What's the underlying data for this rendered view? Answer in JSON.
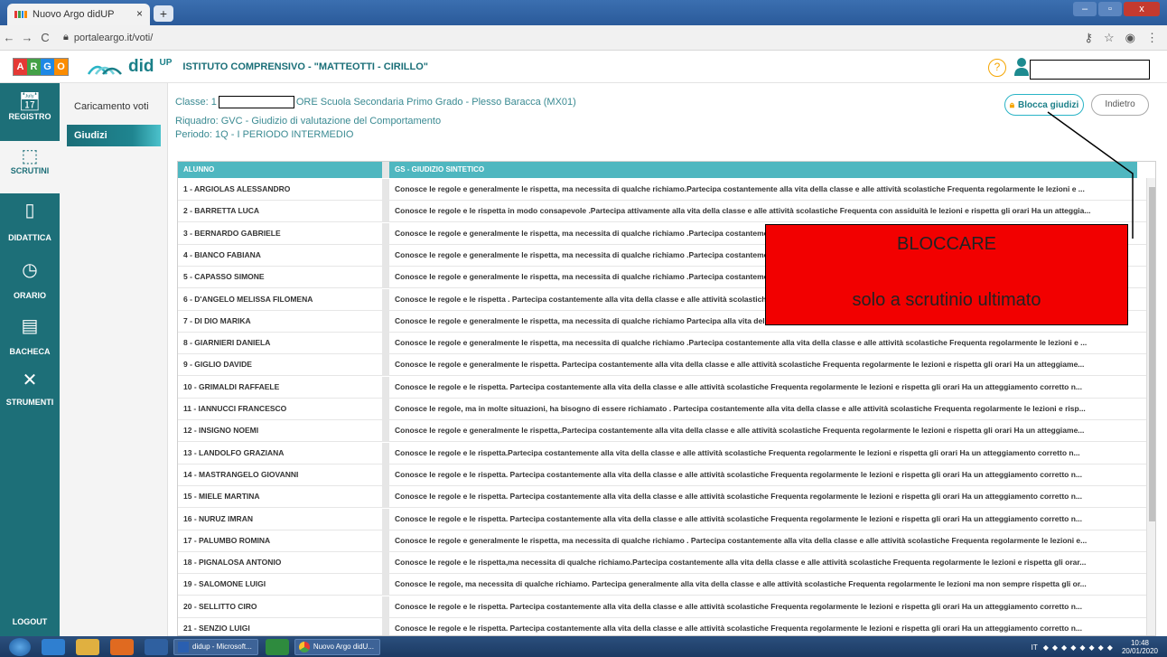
{
  "browser": {
    "tab_title": "Nuovo Argo didUP",
    "tab_close": "×",
    "new_tab": "+",
    "url": "portaleargo.it/voti/",
    "window_controls": [
      "–",
      "▫",
      "x"
    ]
  },
  "header": {
    "brand_letters": [
      "A",
      "R",
      "G",
      "O"
    ],
    "brand_colors": [
      "#e53935",
      "#43a047",
      "#1e88e5",
      "#fb8c00"
    ],
    "app_name": "did",
    "app_sup": "UP",
    "school": "ISTITUTO COMPRENSIVO - \"MATTEOTTI - CIRILLO\"",
    "help_icon": "?"
  },
  "leftnav": {
    "items": [
      {
        "label": "REGISTRO",
        "icon": "calendar-icon"
      },
      {
        "label": "SCRUTINI",
        "icon": "scrutini-icon"
      },
      {
        "label": "DIDATTICA",
        "icon": "book-icon"
      },
      {
        "label": "ORARIO",
        "icon": "clock-icon"
      },
      {
        "label": "BACHECA",
        "icon": "board-icon"
      },
      {
        "label": "STRUMENTI",
        "icon": "tools-icon"
      }
    ],
    "logout": "LOGOUT"
  },
  "submenu": {
    "items": [
      "Caricamento voti",
      "Giudizi"
    ]
  },
  "info": {
    "class_prefix": "Classe: 1",
    "class_suffix": "ORE Scuola Secondaria Primo Grado - Plesso Baracca (MX01)",
    "riquadro": "Riquadro: GVC - Giudizio di valutazione del Comportamento",
    "periodo": "Periodo: 1Q - I PERIODO INTERMEDIO"
  },
  "buttons": {
    "blocca": "Blocca giudizi",
    "indietro": "Indietro"
  },
  "table": {
    "headers": [
      "ALUNNO",
      "GS - GIUDIZIO SINTETICO"
    ],
    "rows": [
      {
        "name": "1 - ARGIOLAS ALESSANDRO",
        "giudizio": "Conosce le regole e generalmente le rispetta, ma necessita di qualche richiamo.Partecipa costantemente alla vita della classe e alle attività scolastiche Frequenta regolarmente le lezioni e ..."
      },
      {
        "name": "2 - BARRETTA LUCA",
        "giudizio": "Conosce le regole e le rispetta in modo consapevole .Partecipa attivamente alla vita della classe e alle attività scolastiche Frequenta con assiduità le lezioni e rispetta gli orari Ha un atteggia..."
      },
      {
        "name": "3 - BERNARDO GABRIELE",
        "giudizio": "Conosce le regole e generalmente le rispetta, ma necessita di qualche richiamo .Partecipa costantemente alla vita della classe e alle attività scolastiche Frequenta regolarmente le lezioni e ..."
      },
      {
        "name": "4 - BIANCO FABIANA",
        "giudizio": "Conosce le regole e generalmente le rispetta, ma necessita di qualche richiamo .Partecipa costantemente alla vita della classe e alle attività scolastiche Frequenta regolarmente le lezioni e ..."
      },
      {
        "name": "5 - CAPASSO SIMONE",
        "giudizio": "Conosce le regole e generalmente le rispetta, ma necessita di qualche richiamo .Partecipa costantemente alla vita della classe e alle attività scolastiche Frequenta regolarmente le lezioni e ..."
      },
      {
        "name": "6 - D'ANGELO MELISSA FILOMENA",
        "giudizio": "Conosce le regole e le rispetta . Partecipa costantemente alla vita della classe e alle attività scolastiche Frequenta regolarmente le lezioni e rispetta gli orari Ha un atteggiamento corretto n..."
      },
      {
        "name": "7 - DI DIO MARIKA",
        "giudizio": "Conosce le regole e generalmente le rispetta, ma necessita di qualche richiamo Partecipa alla vita della classe e alle attività scolastiche Frequenta regolarmente le lezioni e rispetta gli orari..."
      },
      {
        "name": "8 - GIARNIERI DANIELA",
        "giudizio": "Conosce le regole e generalmente le rispetta, ma necessita di qualche richiamo .Partecipa costantemente alla vita della classe e alle attività scolastiche Frequenta regolarmente le lezioni e ..."
      },
      {
        "name": "9 - GIGLIO DAVIDE",
        "giudizio": "Conosce le regole e generalmente le rispetta. Partecipa costantemente alla vita della classe e alle attività scolastiche Frequenta regolarmente le lezioni e rispetta gli orari Ha un atteggiame..."
      },
      {
        "name": "10 - GRIMALDI RAFFAELE",
        "giudizio": "Conosce le regole e le rispetta. Partecipa costantemente alla vita della classe e alle attività scolastiche Frequenta regolarmente le lezioni e rispetta gli orari Ha un atteggiamento corretto n..."
      },
      {
        "name": "11 - IANNUCCI FRANCESCO",
        "giudizio": "Conosce le regole, ma in molte situazioni, ha bisogno di essere richiamato . Partecipa costantemente alla vita della classe e alle attività scolastiche Frequenta regolarmente le lezioni e risp..."
      },
      {
        "name": "12 - INSIGNO NOEMI",
        "giudizio": "Conosce le regole e generalmente le rispetta,.Partecipa costantemente alla vita della classe e alle attività scolastiche Frequenta regolarmente le lezioni e rispetta gli orari Ha un atteggiame..."
      },
      {
        "name": "13 - LANDOLFO GRAZIANA",
        "giudizio": "Conosce le regole e le rispetta.Partecipa costantemente alla vita della classe e alle attività scolastiche Frequenta regolarmente le lezioni e rispetta gli orari Ha un atteggiamento corretto n..."
      },
      {
        "name": "14 - MASTRANGELO GIOVANNI",
        "giudizio": "Conosce le regole e le rispetta. Partecipa costantemente alla vita della classe e alle attività scolastiche Frequenta regolarmente le lezioni e rispetta gli orari Ha un atteggiamento corretto n..."
      },
      {
        "name": "15 - MIELE MARTINA",
        "giudizio": "Conosce le regole e le rispetta. Partecipa costantemente alla vita della classe e alle attività scolastiche Frequenta regolarmente le lezioni e rispetta gli orari Ha un atteggiamento corretto n..."
      },
      {
        "name": "16 - NURUZ IMRAN",
        "giudizio": "Conosce le regole e le rispetta. Partecipa costantemente alla vita della classe e alle attività scolastiche Frequenta regolarmente le lezioni e rispetta gli orari Ha un atteggiamento corretto n..."
      },
      {
        "name": "17 - PALUMBO ROMINA",
        "giudizio": "Conosce le regole e generalmente le rispetta, ma necessita di qualche richiamo . Partecipa costantemente alla vita della classe e alle attività scolastiche Frequenta regolarmente le lezioni e..."
      },
      {
        "name": "18 - PIGNALOSA ANTONIO",
        "giudizio": "Conosce le regole e le rispetta,ma necessita di qualche richiamo.Partecipa costantemente alla vita della classe e alle attività scolastiche Frequenta regolarmente le lezioni e rispetta gli orar..."
      },
      {
        "name": "19 - SALOMONE LUIGI",
        "giudizio": "Conosce le regole, ma necessita di qualche richiamo. Partecipa generalmente alla vita della classe e alle attività scolastiche Frequenta regolarmente le lezioni ma non sempre rispetta gli or..."
      },
      {
        "name": "20 - SELLITTO CIRO",
        "giudizio": "Conosce le regole e le rispetta. Partecipa costantemente alla vita della classe e alle attività scolastiche Frequenta regolarmente le lezioni e rispetta gli orari Ha un atteggiamento corretto n..."
      },
      {
        "name": "21 - SENZIO LUIGI",
        "giudizio": "Conosce le regole e le rispetta. Partecipa costantemente alla vita della classe e alle attività scolastiche Frequenta regolarmente le lezioni e rispetta gli orari Ha un atteggiamento corretto n..."
      }
    ]
  },
  "annotation": {
    "line1": "BLOCCARE",
    "line2": "solo a scrutinio ultimato"
  },
  "taskbar": {
    "task1": "didup - Microsoft...",
    "task2": "Nuovo Argo didU...",
    "tray_lang": "IT",
    "time": "10:48",
    "date": "20/01/2020"
  }
}
